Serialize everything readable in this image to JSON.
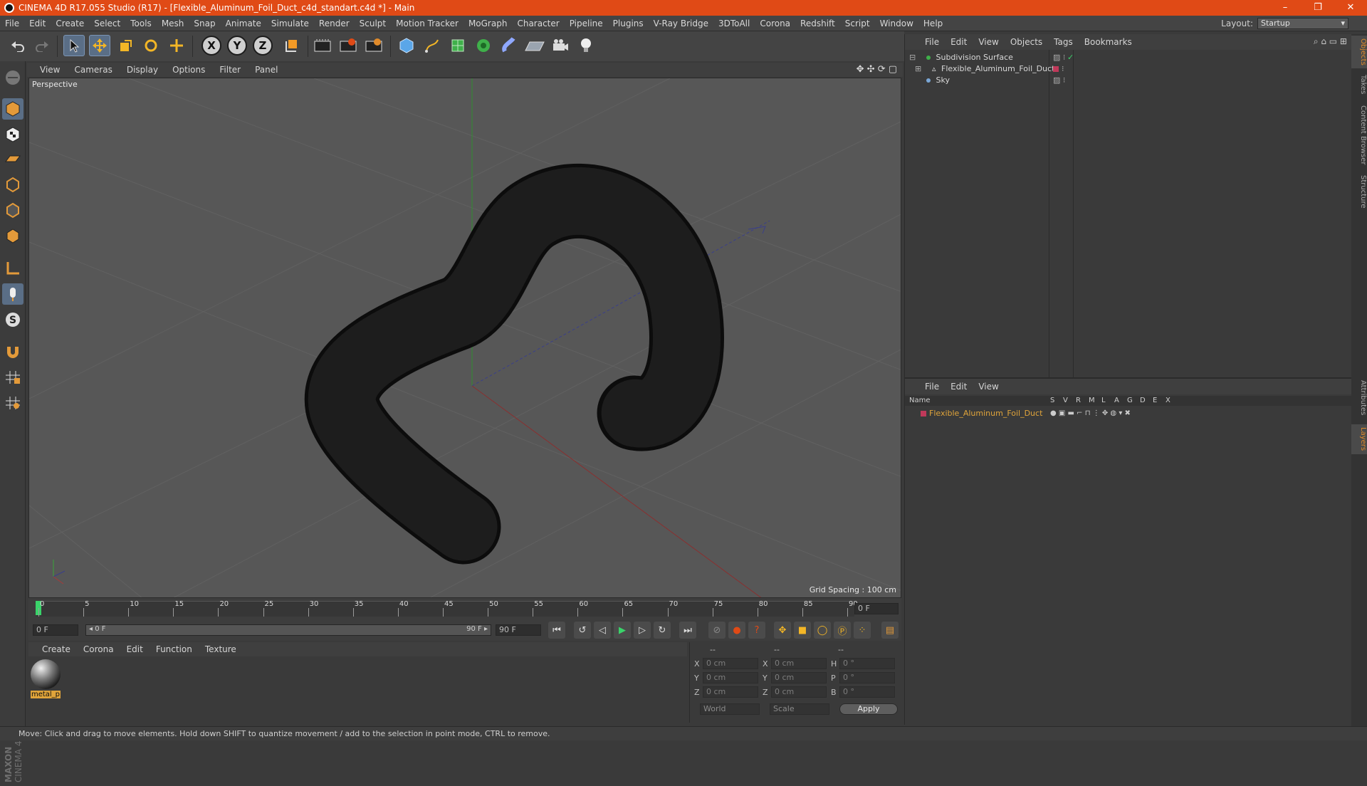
{
  "app": {
    "title": "CINEMA 4D R17.055 Studio (R17) - [Flexible_Aluminum_Foil_Duct_c4d_standart.c4d *] - Main",
    "window_controls": [
      "–",
      "❐",
      "✕"
    ]
  },
  "menu": [
    "File",
    "Edit",
    "Create",
    "Select",
    "Tools",
    "Mesh",
    "Snap",
    "Animate",
    "Simulate",
    "Render",
    "Sculpt",
    "Motion Tracker",
    "MoGraph",
    "Character",
    "Pipeline",
    "Plugins",
    "V-Ray Bridge",
    "3DToAll",
    "Corona",
    "Redshift",
    "Script",
    "Window",
    "Help"
  ],
  "layout": {
    "label": "Layout:",
    "value": "Startup"
  },
  "toolbar": {
    "icons": [
      "undo-icon",
      "redo-icon",
      "select-arrow-icon",
      "move-icon",
      "scale-icon",
      "rotate-icon",
      "move-all-icon",
      "x-axis-icon",
      "y-axis-icon",
      "z-axis-icon",
      "coordinate-system-icon",
      "render-view-icon",
      "render-picture-viewer-icon",
      "edit-render-settings-icon",
      "cube-icon",
      "pen-icon",
      "subdivision-icon",
      "array-icon",
      "deformer-icon",
      "floor-icon",
      "camera-icon",
      "light-icon"
    ],
    "axis_labels": [
      "X",
      "Y",
      "Z"
    ]
  },
  "viewport": {
    "menu": [
      "View",
      "Cameras",
      "Display",
      "Options",
      "Filter",
      "Panel"
    ],
    "label": "Perspective",
    "grid_spacing": "Grid Spacing : 100 cm"
  },
  "timeline": {
    "ticks": [
      "0",
      "5",
      "10",
      "15",
      "20",
      "25",
      "30",
      "35",
      "40",
      "45",
      "50",
      "55",
      "60",
      "65",
      "70",
      "75",
      "80",
      "85",
      "90"
    ],
    "current_frame": "0 F",
    "start_field": "0 F",
    "range_start": "◂ 0 F",
    "range_end": "90 F ▸",
    "end_field": "90 F"
  },
  "materials": {
    "menu": [
      "Create",
      "Corona",
      "Edit",
      "Function",
      "Texture"
    ],
    "items": [
      {
        "name": "metal_p"
      }
    ]
  },
  "coordinates": {
    "headers": [
      "--",
      "--",
      "--"
    ],
    "rows": [
      {
        "a": "X",
        "av": "0 cm",
        "b": "X",
        "bv": "0 cm",
        "c": "H",
        "cv": "0 °"
      },
      {
        "a": "Y",
        "av": "0 cm",
        "b": "Y",
        "bv": "0 cm",
        "c": "P",
        "cv": "0 °"
      },
      {
        "a": "Z",
        "av": "0 cm",
        "b": "Z",
        "bv": "0 cm",
        "c": "B",
        "cv": "0 °"
      }
    ],
    "world": "World",
    "scale": "Scale",
    "apply": "Apply"
  },
  "objects_panel": {
    "menu": [
      "File",
      "Edit",
      "View",
      "Objects",
      "Tags",
      "Bookmarks"
    ],
    "objects": [
      {
        "name": "Subdivision Surface",
        "color": "#8fd36c"
      },
      {
        "name": "Flexible_Aluminum_Foil_Duct",
        "color": "#cfcfcf"
      },
      {
        "name": "Sky",
        "color": "#cfcfcf"
      }
    ]
  },
  "layers_panel": {
    "menu": [
      "File",
      "Edit",
      "View"
    ],
    "header_name": "Name",
    "columns": [
      "S",
      "V",
      "R",
      "M",
      "L",
      "A",
      "G",
      "D",
      "E",
      "X"
    ],
    "layers": [
      {
        "name": "Flexible_Aluminum_Foil_Duct",
        "color": "#e0a43a"
      }
    ]
  },
  "right_tabs": [
    "Objects",
    "Takes",
    "Content Browser",
    "Structure",
    "Attributes",
    "Layers"
  ],
  "status": "Move: Click and drag to move elements. Hold down SHIFT to quantize movement / add to the selection in point mode, CTRL to remove.",
  "brand": "MAXON CINEMA 4D",
  "colors": {
    "title_bar": "#e04a16",
    "accent": "#e08a2a",
    "viewport_bg": "#575757"
  }
}
